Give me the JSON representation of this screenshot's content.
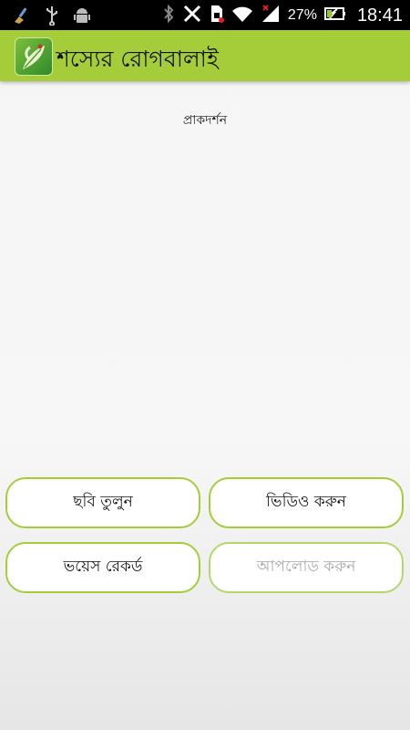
{
  "status_bar": {
    "left_icons": [
      "broom-icon",
      "usb-icon",
      "android-icon"
    ],
    "right_icons": [
      "bluetooth-icon",
      "vibrate-icon",
      "sim-icon",
      "wifi-icon",
      "signal-icon",
      "battery-icon"
    ],
    "battery": "27%",
    "time": "18:41"
  },
  "action_bar": {
    "app_icon": "leaf-icon",
    "title": "শস্যের রোগবালাই",
    "color": "#a5cd39"
  },
  "main": {
    "preview_label": "প্রাকদর্শন"
  },
  "buttons": {
    "take_photo": "ছবি তুলুন",
    "record_video": "ভিডিও করুন",
    "voice_record": "ভয়েস রেকর্ড",
    "upload": "আপলোড করুন"
  }
}
